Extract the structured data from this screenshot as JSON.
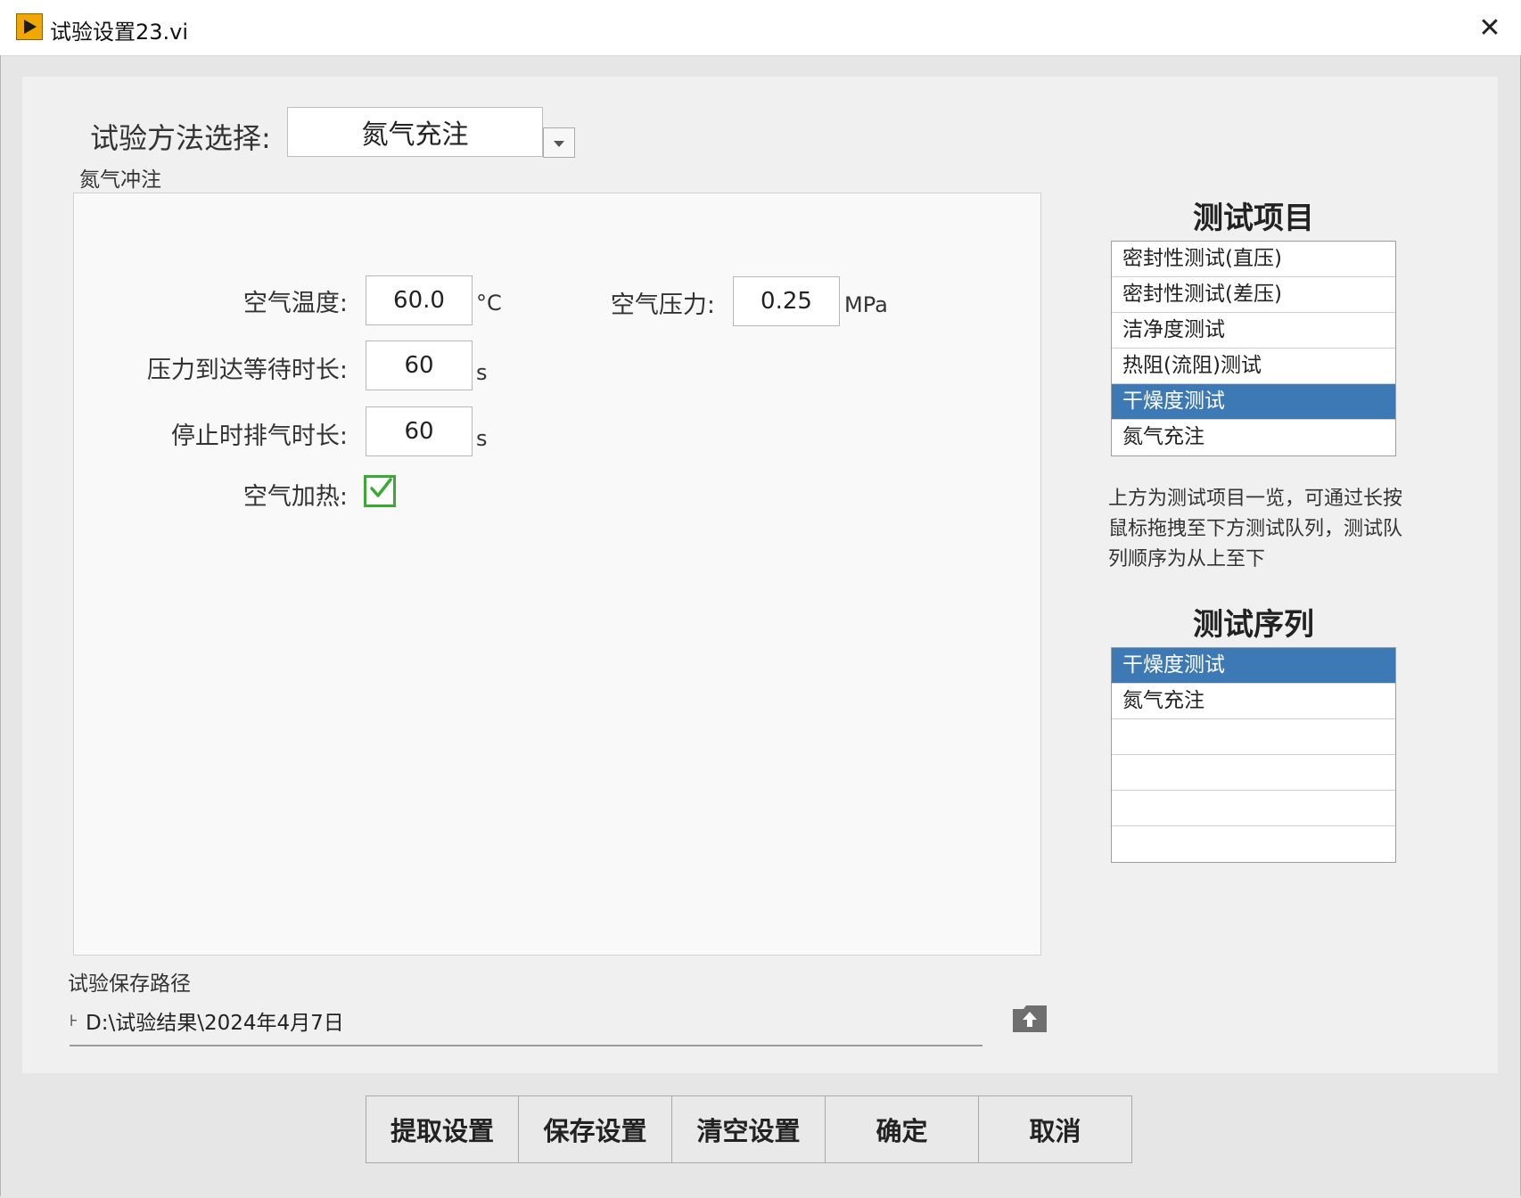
{
  "window": {
    "title": "试验设置23.vi",
    "close_glyph": "✕"
  },
  "method": {
    "label": "试验方法选择:",
    "selected": "氮气充注"
  },
  "group": {
    "label": "氮气冲注"
  },
  "fields": {
    "air_temp": {
      "label": "空气温度:",
      "value": "60.0",
      "unit": "°C"
    },
    "air_pressure": {
      "label": "空气压力:",
      "value": "0.25",
      "unit": "MPa"
    },
    "pressure_wait": {
      "label": "压力到达等待时长:",
      "value": "60",
      "unit": "s"
    },
    "stop_exhaust": {
      "label": "停止时排气时长:",
      "value": "60",
      "unit": "s"
    },
    "air_heating": {
      "label": "空气加热:",
      "checked": true
    }
  },
  "test_items": {
    "title": "测试项目",
    "items": [
      "密封性测试(直压)",
      "密封性测试(差压)",
      "洁净度测试",
      "热阻(流阻)测试",
      "干燥度测试",
      "氮气充注"
    ],
    "selected_index": 4
  },
  "help_text": "上方为测试项目一览，可通过长按鼠标拖拽至下方测试队列，测试队列顺序为从上至下",
  "test_sequence": {
    "title": "测试序列",
    "items": [
      "干燥度测试",
      "氮气充注",
      "",
      "",
      "",
      ""
    ],
    "selected_index": 0
  },
  "save_path": {
    "label": "试验保存路径",
    "value": "D:\\试验结果\\2024年4月7日",
    "path_icon": "path-symbol-icon",
    "browse_icon": "folder-upload-icon"
  },
  "buttons": {
    "extract": "提取设置",
    "save": "保存设置",
    "clear": "清空设置",
    "ok": "确定",
    "cancel": "取消"
  },
  "colors": {
    "selected_row": "#3d7ab5",
    "checkbox": "#3aaa35",
    "app_icon": "#f0a800"
  }
}
